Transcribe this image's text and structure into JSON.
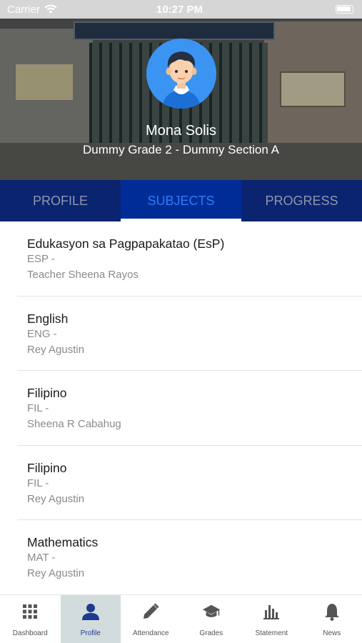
{
  "status_bar": {
    "carrier": "Carrier",
    "time": "10:27 PM"
  },
  "header": {
    "student_name": "Mona  Solis",
    "grade_section": "Dummy Grade 2 - Dummy Section A"
  },
  "tabs": [
    {
      "label": "PROFILE",
      "active": false
    },
    {
      "label": "SUBJECTS",
      "active": true
    },
    {
      "label": "PROGRESS",
      "active": false
    }
  ],
  "subjects": [
    {
      "title": "Edukasyon sa Pagpapakatao (EsP)",
      "code": "ESP -",
      "teacher": "Teacher Sheena   Rayos"
    },
    {
      "title": "English",
      "code": "ENG -",
      "teacher": "Rey  Agustin"
    },
    {
      "title": "Filipino",
      "code": "FIL -",
      "teacher": "Sheena  R Cabahug"
    },
    {
      "title": "Filipino",
      "code": "FIL -",
      "teacher": "Rey  Agustin"
    },
    {
      "title": "Mathematics",
      "code": "MAT -",
      "teacher": "Rey  Agustin"
    }
  ],
  "bottom_nav": [
    {
      "label": "Dashboard",
      "icon": "grid-icon",
      "active": false
    },
    {
      "label": "Profile",
      "icon": "person-icon",
      "active": true
    },
    {
      "label": "Attendance",
      "icon": "pencil-icon",
      "active": false
    },
    {
      "label": "Grades",
      "icon": "graduation-cap-icon",
      "active": false
    },
    {
      "label": "Statement",
      "icon": "bar-chart-icon",
      "active": false
    },
    {
      "label": "News",
      "icon": "bell-icon",
      "active": false
    }
  ],
  "colors": {
    "tab_bar": "#062a80",
    "tab_active_text": "#2e7cf6",
    "avatar_bg": "#3b94f2",
    "nav_active_bg": "#d2dcdc",
    "nav_icon_active": "#1f3b8f"
  }
}
